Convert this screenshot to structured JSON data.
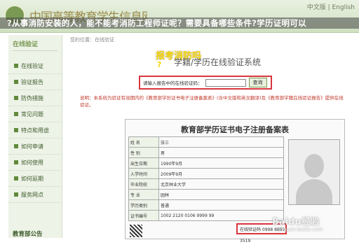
{
  "header": {
    "site_logo": "中国高等教育学生信息网",
    "lang_links": "中文版 | English",
    "headline": "?从事消防安装的人，能不能考消防工程师证呢？需要具备哪些条件?学历证明可以"
  },
  "sidebar": {
    "title": "在线验证",
    "items": [
      {
        "label": "在线验证"
      },
      {
        "label": "验证报告"
      },
      {
        "label": "防伪措施"
      },
      {
        "label": "常见问题"
      },
      {
        "label": "特点和用途"
      },
      {
        "label": "如何申请"
      },
      {
        "label": "如何使用"
      },
      {
        "label": "如何延期"
      },
      {
        "label": "服务网点"
      }
    ],
    "notice": "教育部公告"
  },
  "main": {
    "breadcrumb": "您的位置：在线验证",
    "overlay_title": "报考消防吗",
    "overlay_q": "?",
    "system_title": "学籍/学历在线验证系统",
    "search": {
      "label": "请输入报告中的在线验证码：",
      "button": "查询"
    },
    "note": "说明：本系统为验证有效期内的《教育部学历证书电子注册备案表》(含中文版和英文翻译)及《教育部学籍在线验证报告》提供在线验证。"
  },
  "form": {
    "title": "教育部学历证书电子注册备案表",
    "rows": [
      [
        "姓 名",
        "张三"
      ],
      [
        "性 别",
        "男"
      ],
      [
        "出生日期",
        "1990年9月"
      ],
      [
        "入学时间",
        "2009年9月"
      ],
      [
        "毕业院校",
        "北京林业大学"
      ],
      [
        "专 业",
        "园林"
      ],
      [
        "学历类别",
        "普通"
      ],
      [
        "证书编号",
        "1002 2120 0106 9999 99"
      ]
    ],
    "verify_code": "在线验证码 0998 8889 3519"
  },
  "watermark": {
    "brand": "Baidu经验",
    "url": "jingyan.baidu.com"
  }
}
